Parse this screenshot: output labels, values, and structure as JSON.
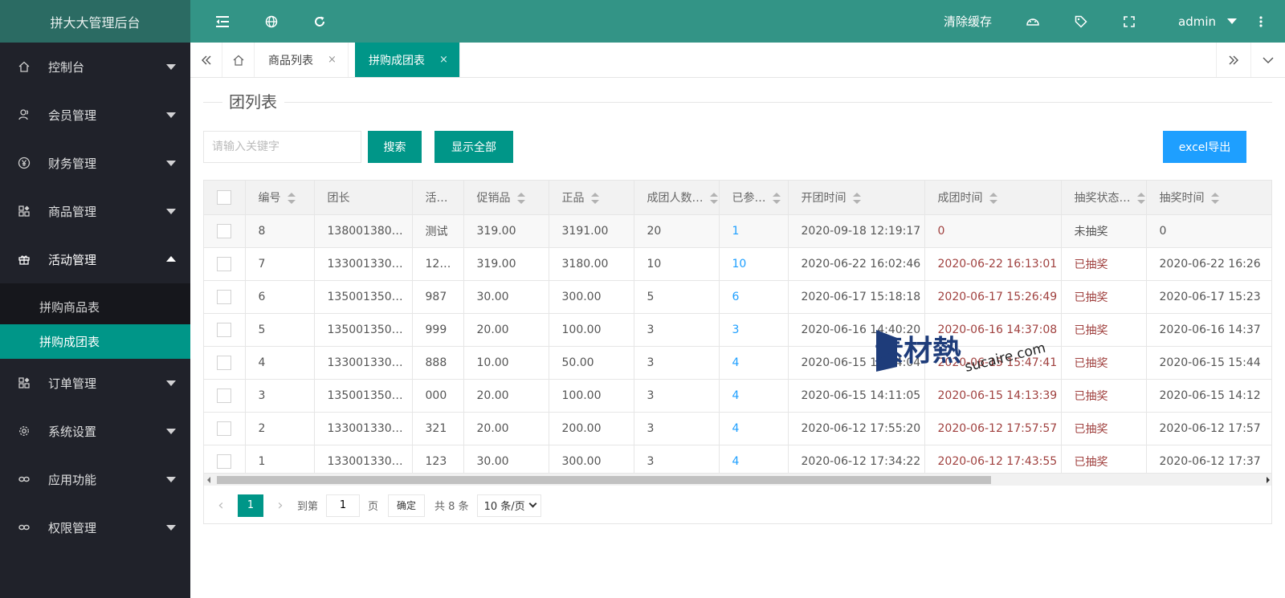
{
  "app": {
    "title": "拼大大管理后台"
  },
  "sidebar": {
    "items": [
      {
        "label": "控制台",
        "icon": "home-icon"
      },
      {
        "label": "会员管理",
        "icon": "users-icon"
      },
      {
        "label": "财务管理",
        "icon": "yen-icon"
      },
      {
        "label": "商品管理",
        "icon": "apps-icon"
      },
      {
        "label": "活动管理",
        "icon": "gift-icon",
        "open": true
      },
      {
        "label": "订单管理",
        "icon": "apps-icon"
      },
      {
        "label": "系统设置",
        "icon": "gear-icon"
      },
      {
        "label": "应用功能",
        "icon": "link-icon"
      },
      {
        "label": "权限管理",
        "icon": "link-icon"
      }
    ],
    "submenu": [
      {
        "label": "拼购商品表"
      },
      {
        "label": "拼购成团表",
        "active": true
      }
    ]
  },
  "header": {
    "clear_cache": "清除缓存",
    "user": "admin"
  },
  "tabs": [
    {
      "label": "商品列表",
      "close": "×"
    },
    {
      "label": "拼购成团表",
      "close": "×",
      "active": true
    }
  ],
  "page": {
    "title": "团列表",
    "search_placeholder": "请输入关键字",
    "search_btn": "搜索",
    "show_all_btn": "显示全部",
    "export_btn": "excel导出"
  },
  "table": {
    "columns": [
      "编号",
      "团长",
      "活…",
      "促销品",
      "正品",
      "成团人数…",
      "已参…",
      "开团时间",
      "成团时间",
      "抽奖状态…",
      "抽奖时间"
    ],
    "rows": [
      [
        "8",
        "138001380…",
        "测试",
        "319.00",
        "3191.00",
        "20",
        "1",
        "2020-09-18 12:19:17",
        "0",
        "未抽奖",
        "0"
      ],
      [
        "7",
        "133001330…",
        "12…",
        "319.00",
        "3180.00",
        "10",
        "10",
        "2020-06-22 16:02:46",
        "2020-06-22 16:13:01",
        "已抽奖",
        "2020-06-22 16:26"
      ],
      [
        "6",
        "135001350…",
        "987",
        "30.00",
        "300.00",
        "5",
        "6",
        "2020-06-17 15:18:18",
        "2020-06-17 15:26:49",
        "已抽奖",
        "2020-06-17 15:23"
      ],
      [
        "5",
        "135001350…",
        "999",
        "20.00",
        "100.00",
        "3",
        "3",
        "2020-06-16 14:40:20",
        "2020-06-16 14:37:08",
        "已抽奖",
        "2020-06-16 14:37"
      ],
      [
        "4",
        "133001330…",
        "888",
        "10.00",
        "50.00",
        "3",
        "4",
        "2020-06-15 15:44:04",
        "2020-06-15 15:47:41",
        "已抽奖",
        "2020-06-15 15:44"
      ],
      [
        "3",
        "135001350…",
        "000",
        "20.00",
        "100.00",
        "3",
        "4",
        "2020-06-15 14:11:05",
        "2020-06-15 14:13:39",
        "已抽奖",
        "2020-06-15 14:12"
      ],
      [
        "2",
        "133001330…",
        "321",
        "20.00",
        "200.00",
        "3",
        "4",
        "2020-06-12 17:55:20",
        "2020-06-12 17:57:57",
        "已抽奖",
        "2020-06-12 17:57"
      ],
      [
        "1",
        "133001330…",
        "123",
        "30.00",
        "300.00",
        "3",
        "4",
        "2020-06-12 17:34:22",
        "2020-06-12 17:43:55",
        "已抽奖",
        "2020-06-12 17:37"
      ]
    ]
  },
  "pager": {
    "current": "1",
    "goto_label": "到第",
    "goto_value": "1",
    "page_label": "页",
    "confirm": "确定",
    "total": "共 8 条",
    "per_page": "10 条/页"
  },
  "watermark": {
    "cn": "素材熱",
    "en": "sucaire.com"
  },
  "colors": {
    "teal": "#009688",
    "header": "#339486",
    "sidebar": "#20222a",
    "blue": "#1e9fff",
    "red": "#a0413f"
  }
}
